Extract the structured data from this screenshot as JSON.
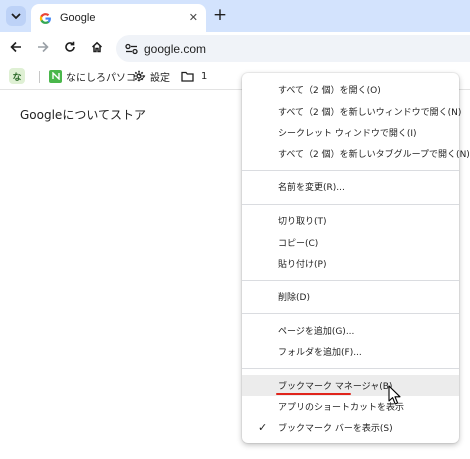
{
  "tabstrip": {
    "tab_title": "Google",
    "favicon_letter": "G",
    "close_glyph": "✕",
    "new_tab_glyph": "+"
  },
  "toolbar": {
    "url": "google.com"
  },
  "bookmarks_bar": {
    "profile_bookmark": "な",
    "items": [
      {
        "label": "なにしろパソコン"
      },
      {
        "label": "設定"
      },
      {
        "label": "1"
      }
    ]
  },
  "page": {
    "links": [
      "Googleについて",
      "ストア"
    ]
  },
  "context_menu": {
    "groups": [
      [
        "すべて（2 個）を開く(O)",
        "すべて（2 個）を新しいウィンドウで開く(N)",
        "シークレット ウィンドウで開く(I)",
        "すべて（2 個）を新しいタブグループで開く(N)"
      ],
      [
        "名前を変更(R)..."
      ],
      [
        "切り取り(T)",
        "コピー(C)",
        "貼り付け(P)"
      ],
      [
        "削除(D)"
      ],
      [
        "ページを追加(G)...",
        "フォルダを追加(F)..."
      ],
      [
        "ブックマーク マネージャ(B)",
        "アプリのショートカットを表示",
        "ブックマーク バーを表示(S)"
      ]
    ],
    "highlighted_item": "ブックマーク マネージャ(B)",
    "checked_item": "ブックマーク バーを表示(S)"
  },
  "colors": {
    "tabstrip_bg": "#d3e3fd",
    "annotation_underline": "#e0241b"
  }
}
